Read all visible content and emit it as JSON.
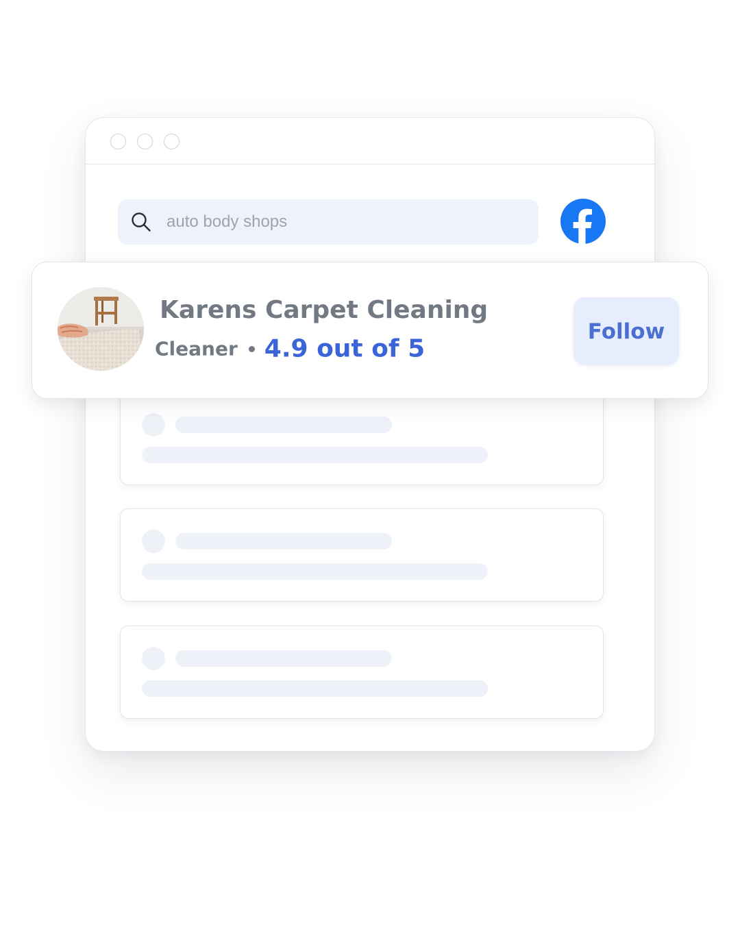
{
  "search": {
    "query": "auto body shops"
  },
  "brand": {
    "icon": "facebook-icon",
    "color": "#1877f2"
  },
  "featured_result": {
    "name": "Karens Carpet Cleaning",
    "category": "Cleaner",
    "rating_text": "4.9 out of 5",
    "follow_label": "Follow",
    "accent_color": "#3a64d8"
  },
  "placeholder_results": [
    {
      "state": "loading"
    },
    {
      "state": "loading"
    },
    {
      "state": "loading"
    },
    {
      "state": "loading"
    }
  ]
}
